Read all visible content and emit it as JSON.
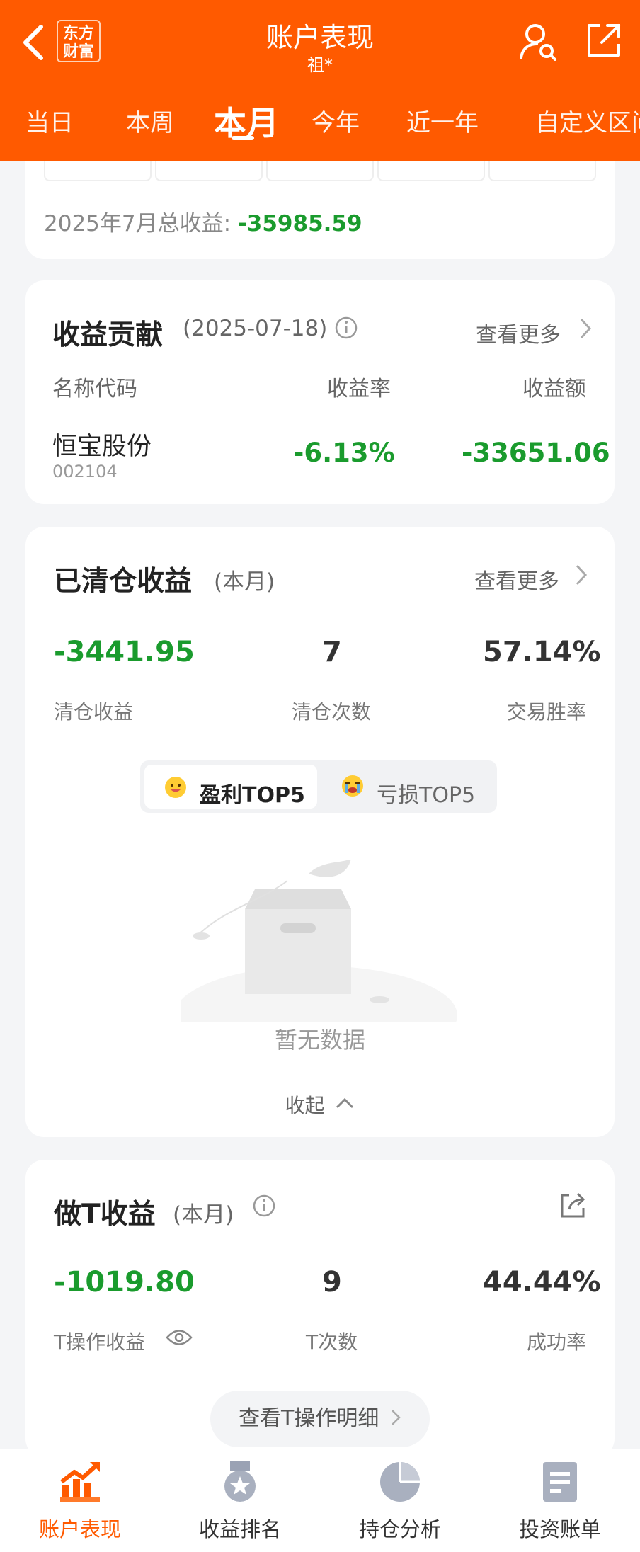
{
  "header": {
    "logo_text": "东方财富",
    "title": "账户表现",
    "subtitle": "祖*",
    "tabs": [
      "当日",
      "本周",
      "本月",
      "今年",
      "近一年",
      "自定义区间"
    ],
    "active_tab": "本月"
  },
  "summary": {
    "total_label": "2025年7月总收益: ",
    "total_value": "-35985.59"
  },
  "contribution": {
    "title": "收益贡献",
    "date": "(2025-07-18)",
    "more": "查看更多",
    "col_name": "名称代码",
    "col_rate": "收益率",
    "col_amount": "收益额",
    "rows": [
      {
        "name": "恒宝股份",
        "code": "002104",
        "rate": "-6.13%",
        "amount": "-33651.06"
      }
    ]
  },
  "cleared": {
    "title": "已清仓收益",
    "period": "(本月)",
    "more": "查看更多",
    "profit_value": "-3441.95",
    "profit_label": "清仓收益",
    "count_value": "7",
    "count_label": "清仓次数",
    "winrate_value": "57.14%",
    "winrate_label": "交易胜率",
    "seg_profit": "盈利TOP5",
    "seg_loss": "亏损TOP5",
    "empty_text": "暂无数据",
    "collapse": "收起"
  },
  "t_trade": {
    "title": "做T收益",
    "period": "(本月)",
    "profit_value": "-1019.80",
    "profit_label": "T操作收益",
    "count_value": "9",
    "count_label": "T次数",
    "success_value": "44.44%",
    "success_label": "成功率",
    "detail_button": "查看T操作明细"
  },
  "bottom_nav": [
    {
      "label": "账户表现",
      "icon": "chart-trend-icon"
    },
    {
      "label": "收益排名",
      "icon": "medal-icon"
    },
    {
      "label": "持仓分析",
      "icon": "pie-chart-icon"
    },
    {
      "label": "投资账单",
      "icon": "bill-icon"
    }
  ],
  "colors": {
    "brand": "#ff5a00",
    "loss": "#1a9b2d"
  }
}
